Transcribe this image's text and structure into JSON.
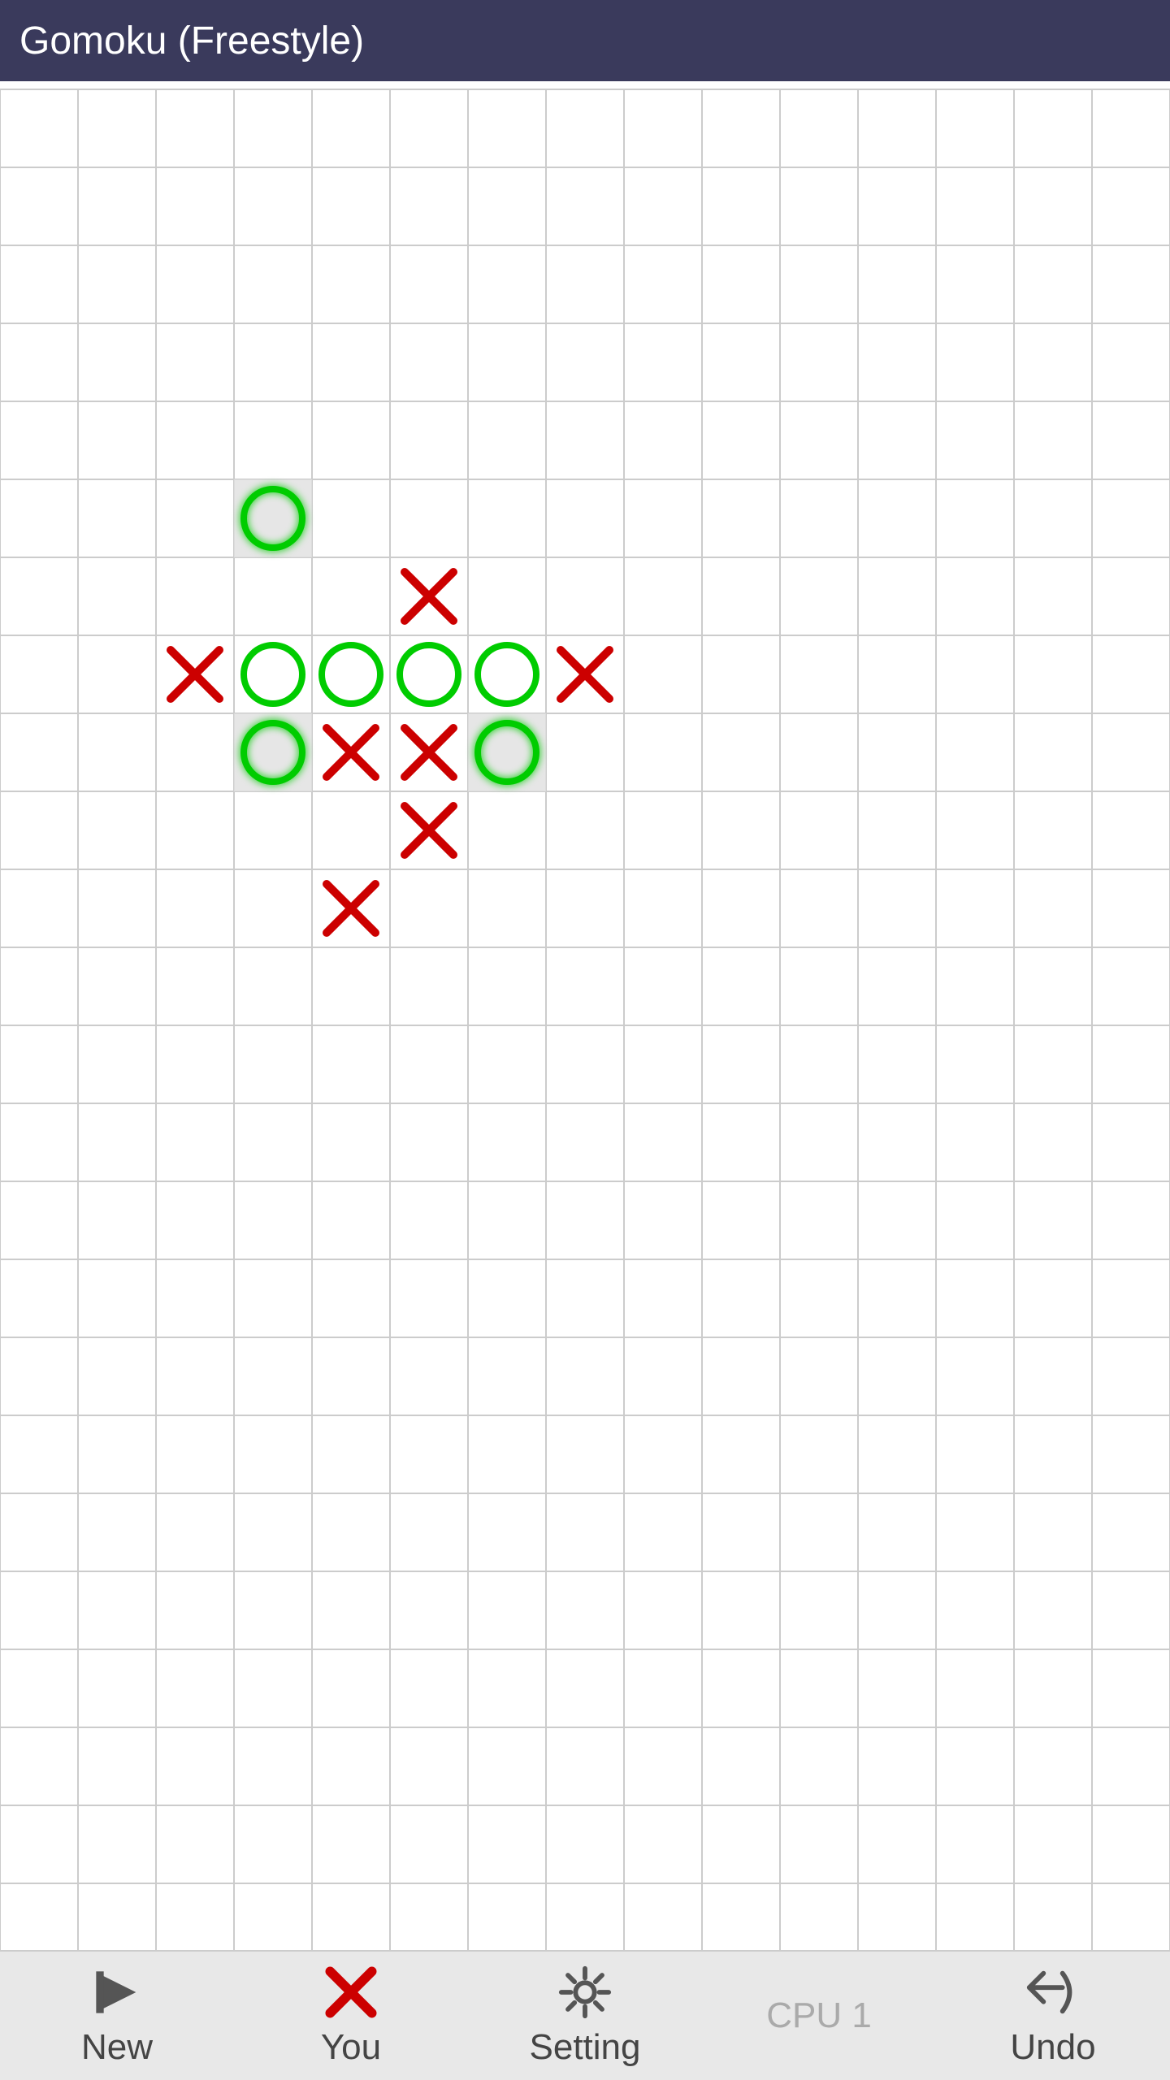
{
  "title": "Gomoku (Freestyle)",
  "board": {
    "cols": 15,
    "rows": 22,
    "cell_size": 96,
    "offset_x": 0,
    "offset_y": 0
  },
  "pieces": {
    "circles": [
      {
        "col": 3,
        "row": 5,
        "highlight": true
      },
      {
        "col": 3,
        "row": 7,
        "highlight": false
      },
      {
        "col": 4,
        "row": 7,
        "highlight": false
      },
      {
        "col": 5,
        "row": 7,
        "highlight": false
      },
      {
        "col": 6,
        "row": 7,
        "highlight": false
      },
      {
        "col": 3,
        "row": 8,
        "highlight": true
      },
      {
        "col": 6,
        "row": 8,
        "highlight": true
      }
    ],
    "crosses": [
      {
        "col": 5,
        "row": 6
      },
      {
        "col": 2,
        "row": 7
      },
      {
        "col": 7,
        "row": 7
      },
      {
        "col": 4,
        "row": 8
      },
      {
        "col": 5,
        "row": 8
      },
      {
        "col": 5,
        "row": 9
      },
      {
        "col": 4,
        "row": 10
      }
    ]
  },
  "bottom_bar": {
    "new_label": "New",
    "you_label": "You",
    "setting_label": "Setting",
    "cpu_label": "CPU 1",
    "undo_label": "Undo"
  },
  "colors": {
    "title_bg": "#3a3a5c",
    "title_text": "#ffffff",
    "grid_line": "#cccccc",
    "board_bg": "#ffffff",
    "circle_color": "#00cc00",
    "cross_color": "#cc0000",
    "bottom_bar_bg": "#e8e8e8",
    "highlight_cell": "#e0e0e0"
  }
}
